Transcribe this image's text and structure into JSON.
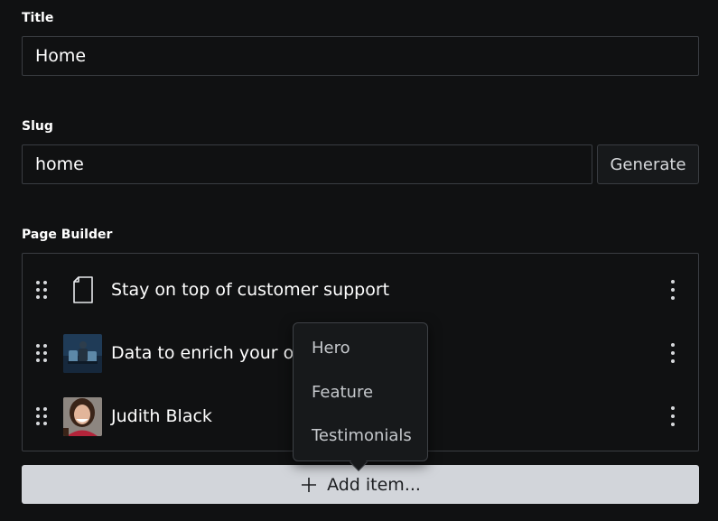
{
  "fields": {
    "title": {
      "label": "Title",
      "value": "Home"
    },
    "slug": {
      "label": "Slug",
      "value": "home",
      "generate_label": "Generate"
    }
  },
  "page_builder": {
    "label": "Page Builder",
    "items": [
      {
        "title": "Stay on top of customer support",
        "icon": "document-icon"
      },
      {
        "title": "Data to enrich your onl",
        "icon": "image-thumbnail"
      },
      {
        "title": "Judith Black",
        "icon": "avatar-thumbnail"
      }
    ],
    "add_item_label": "Add item..."
  },
  "add_menu": {
    "options": [
      "Hero",
      "Feature",
      "Testimonials"
    ]
  },
  "colors": {
    "background": "#101112",
    "border": "#3a3d42",
    "button_light": "#d2d5da"
  }
}
